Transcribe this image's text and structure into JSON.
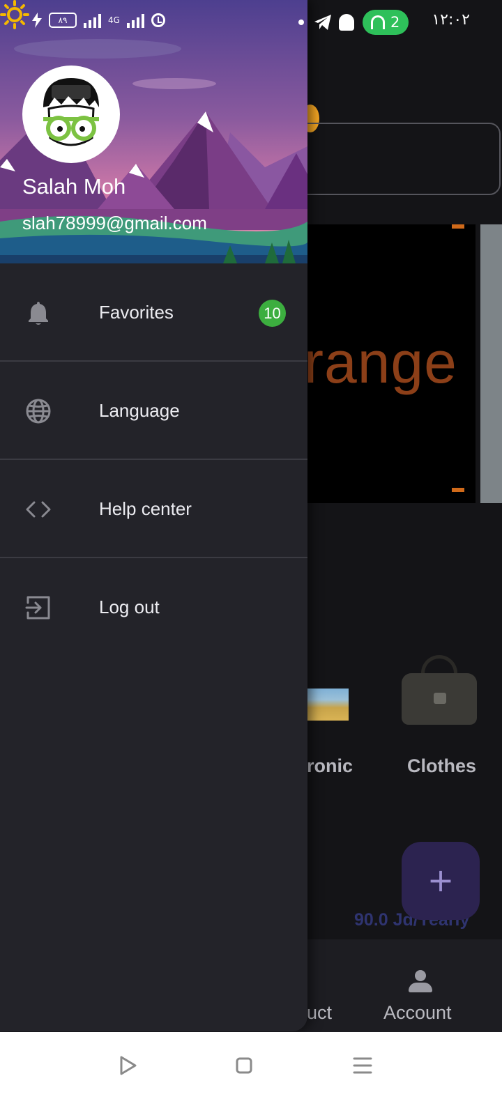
{
  "status_bar": {
    "battery": "٨٩",
    "network_type": "4G",
    "hotspot_count": "2",
    "time": "١٢:٠٢"
  },
  "drawer": {
    "user_name": "Salah Moh",
    "user_email": "slah78999@gmail.com",
    "menu_items": [
      {
        "label": "Favorites",
        "icon": "bell-icon",
        "badge": "10"
      },
      {
        "label": "Language",
        "icon": "globe-icon"
      },
      {
        "label": "Help center",
        "icon": "code-icon"
      },
      {
        "label": "Log out",
        "icon": "logout-icon"
      }
    ]
  },
  "background_app": {
    "banner_text": "range",
    "categories": [
      "ronic",
      "Clothes"
    ],
    "fab_label": "+",
    "price": "90.0 Jd/Yearly",
    "bottom_nav": [
      "uct",
      "Account"
    ]
  },
  "colors": {
    "drawer_bg": "#232329",
    "badge_green": "#3cae3f",
    "hotspot_green": "#2ec05a",
    "fab_purple": "#2c2350",
    "sun_yellow": "#f5b800"
  }
}
